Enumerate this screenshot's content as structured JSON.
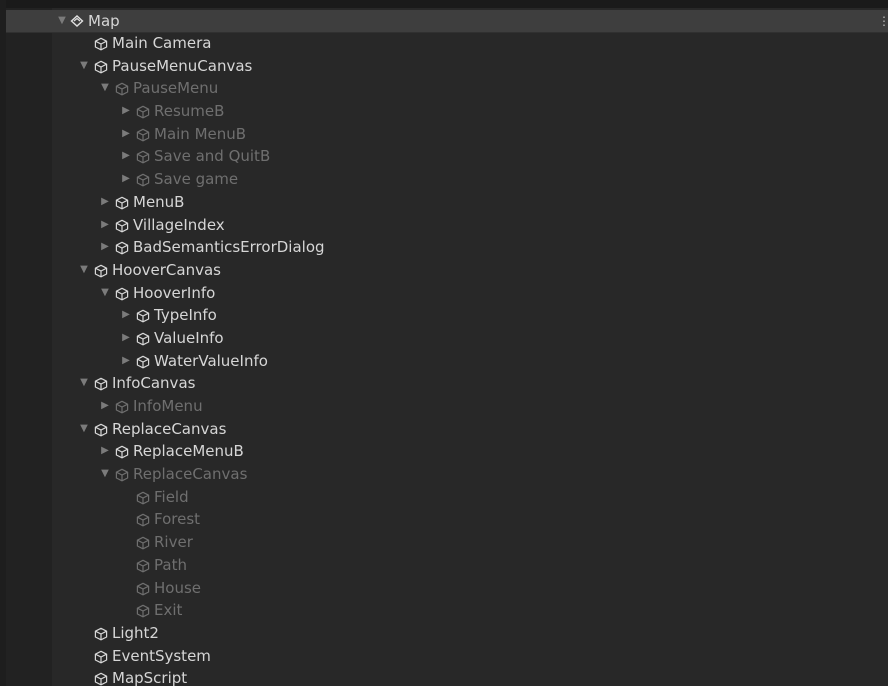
{
  "hierarchy": {
    "scene_name": "Map",
    "menu_glyph": "⋮",
    "arrows": {
      "expanded": "▼",
      "collapsed": "▶"
    },
    "icons": {
      "scene": "unity-scene-icon",
      "gameobject": "gameobject-cube-icon"
    },
    "rows": [
      {
        "label": "Main Camera",
        "depth": 1,
        "arrow": "none",
        "dim": false
      },
      {
        "label": "PauseMenuCanvas",
        "depth": 1,
        "arrow": "expanded",
        "dim": false
      },
      {
        "label": "PauseMenu",
        "depth": 2,
        "arrow": "expanded",
        "dim": true
      },
      {
        "label": "ResumeB",
        "depth": 3,
        "arrow": "collapsed",
        "dim": true
      },
      {
        "label": "Main MenuB",
        "depth": 3,
        "arrow": "collapsed",
        "dim": true
      },
      {
        "label": "Save and QuitB",
        "depth": 3,
        "arrow": "collapsed",
        "dim": true
      },
      {
        "label": "Save game",
        "depth": 3,
        "arrow": "collapsed",
        "dim": true
      },
      {
        "label": "MenuB",
        "depth": 2,
        "arrow": "collapsed",
        "dim": false
      },
      {
        "label": "VillageIndex",
        "depth": 2,
        "arrow": "collapsed",
        "dim": false
      },
      {
        "label": "BadSemanticsErrorDialog",
        "depth": 2,
        "arrow": "collapsed",
        "dim": false
      },
      {
        "label": "HooverCanvas",
        "depth": 1,
        "arrow": "expanded",
        "dim": false
      },
      {
        "label": "HooverInfo",
        "depth": 2,
        "arrow": "expanded",
        "dim": false
      },
      {
        "label": "TypeInfo",
        "depth": 3,
        "arrow": "collapsed",
        "dim": false
      },
      {
        "label": "ValueInfo",
        "depth": 3,
        "arrow": "collapsed",
        "dim": false
      },
      {
        "label": "WaterValueInfo",
        "depth": 3,
        "arrow": "collapsed",
        "dim": false
      },
      {
        "label": "InfoCanvas",
        "depth": 1,
        "arrow": "expanded",
        "dim": false
      },
      {
        "label": "InfoMenu",
        "depth": 2,
        "arrow": "collapsed",
        "dim": true
      },
      {
        "label": "ReplaceCanvas",
        "depth": 1,
        "arrow": "expanded",
        "dim": false
      },
      {
        "label": "ReplaceMenuB",
        "depth": 2,
        "arrow": "collapsed",
        "dim": false
      },
      {
        "label": "ReplaceCanvas",
        "depth": 2,
        "arrow": "expanded",
        "dim": true
      },
      {
        "label": "Field",
        "depth": 3,
        "arrow": "none",
        "dim": true
      },
      {
        "label": "Forest",
        "depth": 3,
        "arrow": "none",
        "dim": true
      },
      {
        "label": "River",
        "depth": 3,
        "arrow": "none",
        "dim": true
      },
      {
        "label": "Path",
        "depth": 3,
        "arrow": "none",
        "dim": true
      },
      {
        "label": "House",
        "depth": 3,
        "arrow": "none",
        "dim": true
      },
      {
        "label": "Exit",
        "depth": 3,
        "arrow": "none",
        "dim": true
      },
      {
        "label": "Light2",
        "depth": 1,
        "arrow": "none",
        "dim": false
      },
      {
        "label": "EventSystem",
        "depth": 1,
        "arrow": "none",
        "dim": false
      },
      {
        "label": "MapScript",
        "depth": 1,
        "arrow": "none",
        "dim": false
      }
    ]
  }
}
